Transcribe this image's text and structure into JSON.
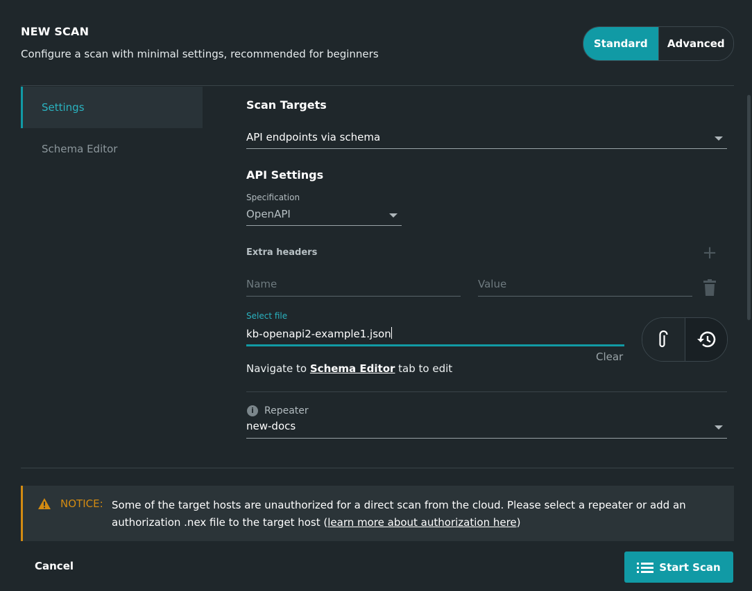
{
  "header": {
    "title": "NEW SCAN",
    "subtitle": "Configure a scan with minimal settings, recommended for beginners",
    "modes": {
      "standard": "Standard",
      "advanced": "Advanced",
      "selected": "Standard"
    }
  },
  "sidebar": {
    "items": [
      {
        "label": "Settings",
        "active": true
      },
      {
        "label": "Schema Editor",
        "active": false
      }
    ]
  },
  "scan_targets": {
    "title": "Scan Targets",
    "value": "API endpoints via schema"
  },
  "api_settings": {
    "title": "API Settings",
    "specification_label": "Specification",
    "specification_value": "OpenAPI",
    "extra_headers_label": "Extra headers",
    "name_placeholder": "Name",
    "value_placeholder": "Value"
  },
  "file": {
    "label": "Select file",
    "value": "kb-openapi2-example1.json",
    "clear_label": "Clear"
  },
  "navigate": {
    "prefix": "Navigate to ",
    "link": "Schema Editor",
    "suffix": " tab to edit"
  },
  "repeater": {
    "label": "Repeater",
    "value": "new-docs"
  },
  "notice": {
    "label": "NOTICE:",
    "text_part1": "Some of the target hosts are unauthorized for a direct scan from the cloud. Please select a repeater or add an authorization .nex file to the target host (",
    "link": "learn more about authorization here",
    "text_part2": ")"
  },
  "footer": {
    "cancel_label": "Cancel",
    "start_label": "Start Scan"
  },
  "colors": {
    "accent": "#119aa5",
    "warning": "#d38b12",
    "background": "#1f272b"
  }
}
